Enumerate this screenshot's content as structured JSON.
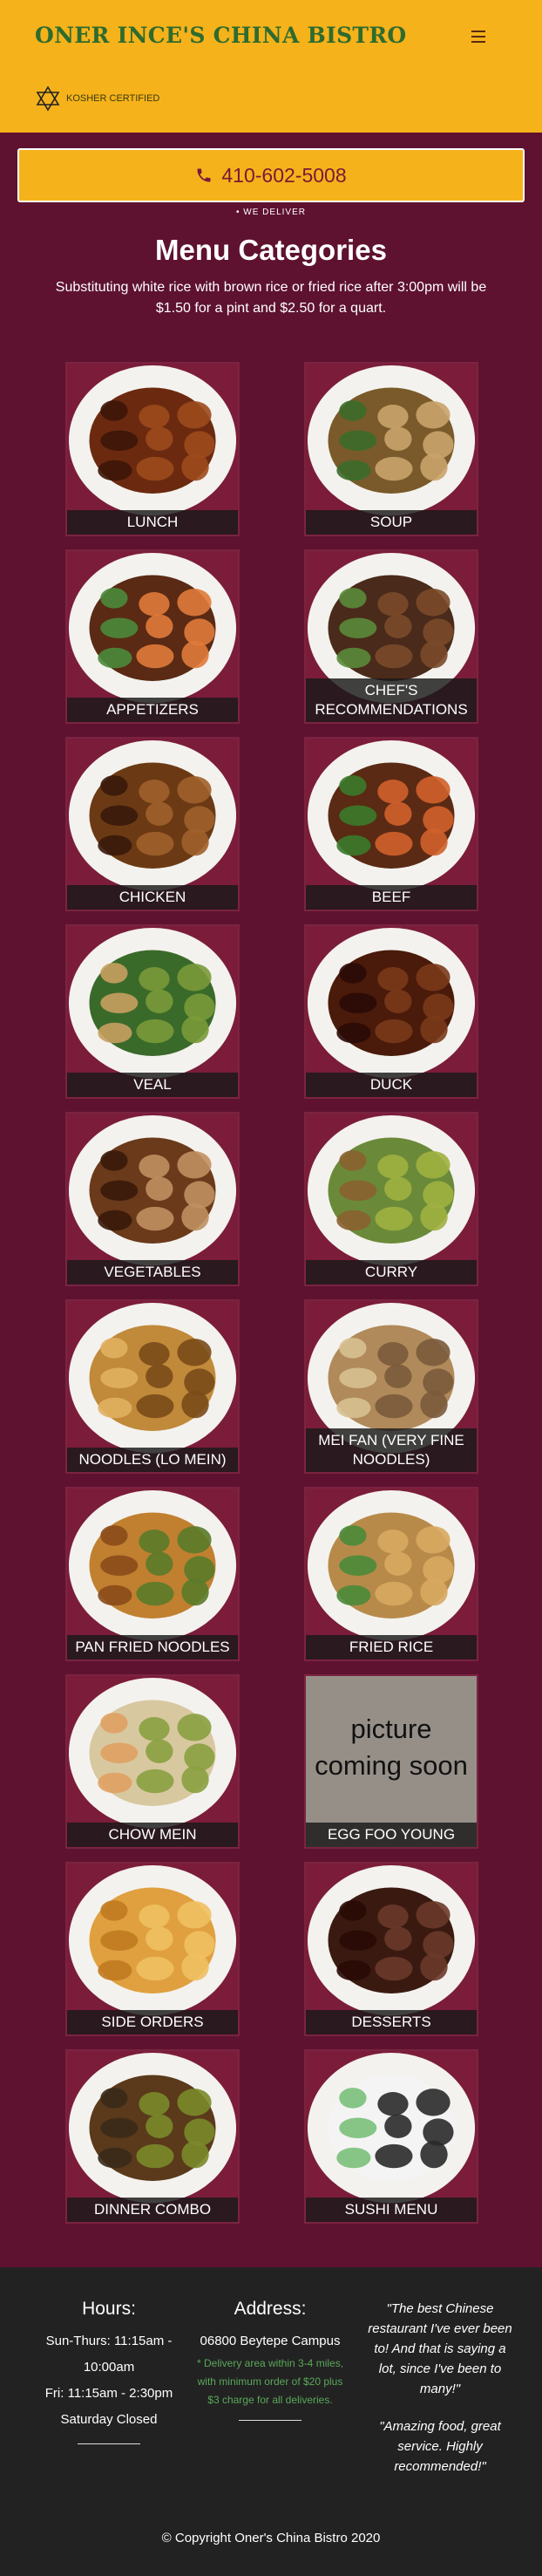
{
  "header": {
    "brand": "ONER INCE'S CHINA BISTRO",
    "kosher_label": "KOSHER CERTIFIED"
  },
  "phone": {
    "number": "410-602-5008",
    "deliver_label": "• WE DELIVER"
  },
  "menu": {
    "title": "Menu Categories",
    "note": "Substituting white rice with brown rice or fried rice after 3:00pm will be $1.50 for a pint and $2.50 for a quart.",
    "categories": [
      {
        "label": "LUNCH"
      },
      {
        "label": "SOUP"
      },
      {
        "label": "APPETIZERS"
      },
      {
        "label": "CHEF'S RECOMMENDATIONS"
      },
      {
        "label": "CHICKEN"
      },
      {
        "label": "BEEF"
      },
      {
        "label": "VEAL"
      },
      {
        "label": "DUCK"
      },
      {
        "label": "VEGETABLES"
      },
      {
        "label": "CURRY"
      },
      {
        "label": "NOODLES (LO MEIN)"
      },
      {
        "label": "MEI FAN (VERY FINE NOODLES)"
      },
      {
        "label": "PAN FRIED NOODLES"
      },
      {
        "label": "FRIED RICE"
      },
      {
        "label": "CHOW MEIN"
      },
      {
        "label": "EGG FOO YOUNG",
        "placeholder": "picture coming soon"
      },
      {
        "label": "SIDE ORDERS"
      },
      {
        "label": "DESSERTS"
      },
      {
        "label": "DINNER COMBO"
      },
      {
        "label": "SUSHI MENU"
      }
    ]
  },
  "footer": {
    "hours_title": "Hours:",
    "hours_lines": [
      "Sun-Thurs: 11:15am - 10:00am",
      "Fri: 11:15am - 2:30pm",
      "Saturday Closed"
    ],
    "address_title": "Address:",
    "address_lines": [
      "06800 Beytepe Campus"
    ],
    "delivery_note": "* Delivery area within 3-4 miles, with minimum order of $20 plus $3 charge for all deliveries.",
    "quotes": [
      "\"The best Chinese restaurant I've ever been to! And that is saying a lot, since I've been to many!\"",
      "\"Amazing food, great service. Highly recommended!\""
    ],
    "copyright": "© Copyright Oner's China Bistro 2020"
  },
  "colors": {
    "brand_yellow": "#f5b21a",
    "maroon": "#5e1230",
    "footer_dark": "#222222",
    "brand_green": "#2e6b2e",
    "phone_text": "#7a1838"
  },
  "icons": {
    "menu": "hamburger-icon",
    "kosher": "star-of-david-icon",
    "phone": "phone-icon"
  }
}
